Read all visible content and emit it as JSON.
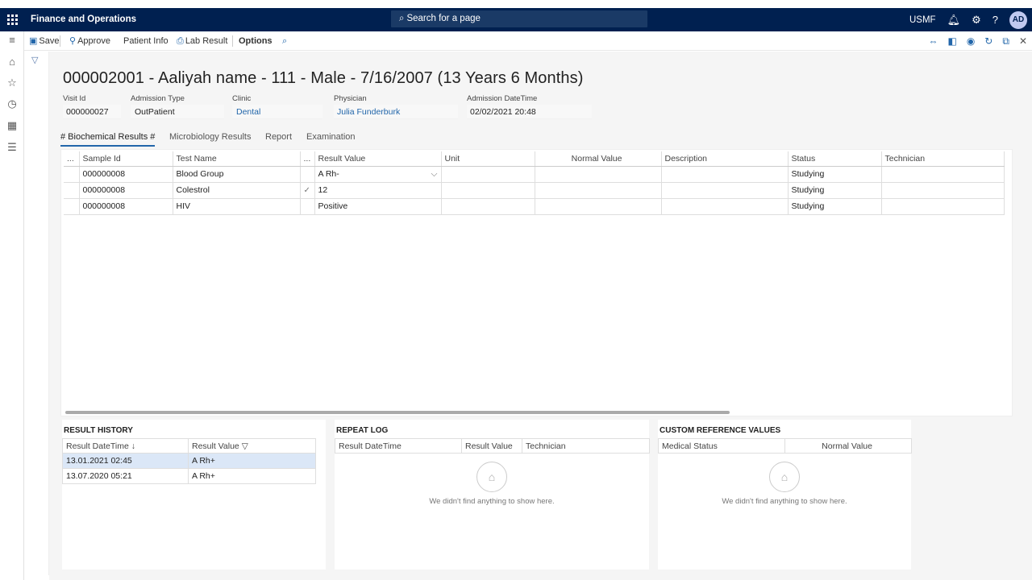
{
  "topbar": {
    "app_name": "Finance and Operations",
    "search_placeholder": "Search for a page",
    "company": "USMF",
    "help_label": "?",
    "avatar_initials": "AD"
  },
  "actionbar": {
    "save": "Save",
    "approve": "Approve",
    "patient_info": "Patient Info",
    "lab_result": "Lab Result",
    "options": "Options"
  },
  "header": {
    "title": "000002001 - Aaliyah name - 111 - Male - 7/16/2007 (13 Years 6 Months)",
    "fields": {
      "visit_id": {
        "label": "Visit Id",
        "value": "000000027"
      },
      "admission_type": {
        "label": "Admission Type",
        "value": "OutPatient"
      },
      "clinic": {
        "label": "Clinic",
        "value": "Dental"
      },
      "physician": {
        "label": "Physician",
        "value": "Julia Funderburk"
      },
      "admission_datetime": {
        "label": "Admission DateTime",
        "value": "02/02/2021 20:48"
      }
    }
  },
  "tabs": [
    "# Biochemical Results #",
    "Microbiology Results",
    "Report",
    "Examination"
  ],
  "grid": {
    "columns": [
      "...",
      "Sample Id",
      "Test Name",
      "...",
      "Result Value",
      "Unit",
      "Normal Value",
      "Description",
      "Status",
      "Technician"
    ],
    "rows": [
      {
        "sample_id": "000000008",
        "test_name": "Blood Group",
        "mark": "",
        "result": "A Rh-",
        "unit": "",
        "normal": "",
        "description": "",
        "status": "Studying",
        "technician": ""
      },
      {
        "sample_id": "000000008",
        "test_name": "Colestrol",
        "mark": "✓",
        "result": "12",
        "unit": "",
        "normal": "",
        "description": "",
        "status": "Studying",
        "technician": ""
      },
      {
        "sample_id": "000000008",
        "test_name": "HIV",
        "mark": "",
        "result": "Positive",
        "unit": "",
        "normal": "",
        "description": "",
        "status": "Studying",
        "technician": ""
      }
    ]
  },
  "result_history": {
    "title": "RESULT HISTORY",
    "columns": [
      "Result DateTime ↓",
      "Result Value"
    ],
    "rows": [
      {
        "datetime": "13.01.2021 02:45",
        "value": "A Rh+"
      },
      {
        "datetime": "13.07.2020 05:21",
        "value": "A Rh+"
      }
    ]
  },
  "repeat_log": {
    "title": "REPEAT LOG",
    "columns": [
      "Result DateTime",
      "Result Value",
      "Technician"
    ],
    "empty_text": "We didn't find anything to show here."
  },
  "custom_reference": {
    "title": "CUSTOM REFERENCE VALUES",
    "columns": [
      "Medical Status",
      "Normal Value"
    ],
    "empty_text": "We didn't find anything to show here."
  },
  "colors": {
    "topbar": "#002050",
    "accent": "#2266aa",
    "selected_row": "#dbe7f7"
  }
}
